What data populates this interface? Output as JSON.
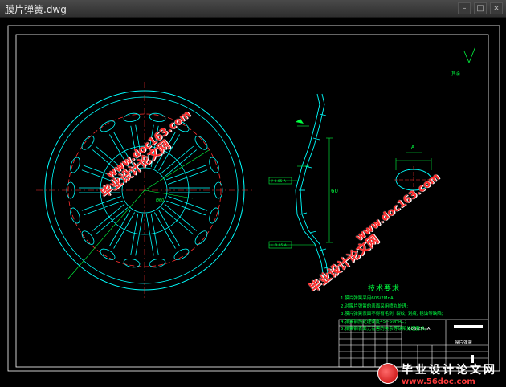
{
  "window": {
    "title": "膜片弹簧.dwg",
    "buttons": [
      "–",
      "□",
      "×"
    ]
  },
  "drawing": {
    "roughness_note": "其余",
    "section_label": "A",
    "labels": {
      "dim_center": "Ø60",
      "gdt_1": "// 0.05 A",
      "gdt_2": "⊥ 0.05 A",
      "view_label": "A",
      "side_mark": "60"
    },
    "tech_requirements": {
      "heading": "技术要求",
      "items": [
        "1.膜片弹簧采用60Si2MnA;",
        "2.对膜片弹簧的表面采用喷丸处理;",
        "3.膜片弹簧表面不得有毛刺, 裂纹, 划痕, 锈蚀等缺陷;",
        "4.弹簧钢热处理硬度45~50HRC;",
        "5.弹簧钢表面无有害的夹杂等缺陷处理要求。"
      ]
    },
    "title_block": {
      "material": "60Si2MnA",
      "part_name": "膜片弹簧"
    }
  },
  "watermarks": {
    "site_cn": "毕业设计论文网",
    "site_url": "www.doc163.com"
  },
  "logo": {
    "line1": "毕业设计论文网",
    "line2": "www.56doc.com"
  }
}
